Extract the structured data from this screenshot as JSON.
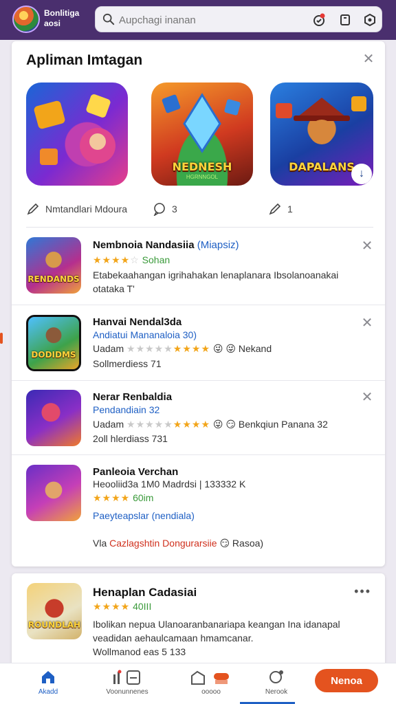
{
  "app": {
    "name": "Bonlitiga",
    "name_line2": "aosi"
  },
  "search": {
    "placeholder": "Aupchagi inanan",
    "badge_color": "#e53935"
  },
  "card1": {
    "title": "Apliman Imtagan",
    "featured": [
      {
        "caption": "",
        "sub": ""
      },
      {
        "caption": "NEDNESH",
        "sub": "HGRNNGOL"
      },
      {
        "caption": "DAPALANS",
        "sub": "",
        "icon": "download-arrow-icon"
      }
    ],
    "actions": [
      {
        "icon": "pen-icon",
        "label": "Nmtandlari Mdoura"
      },
      {
        "icon": "comment-icon",
        "label": "3"
      },
      {
        "icon": "pencil-icon",
        "label": "1"
      }
    ],
    "rows": [
      {
        "title": "Nembnoia Nandasiia",
        "dev": "(Miapsiz)",
        "rating_stars": "★★★★",
        "rating_empty": "☆",
        "rating_text": "Sohan",
        "desc1": "Etabekaahangan igrihahakan lenaplanara Ibsolanoanakai",
        "desc2": "otataka T'",
        "thumb_word": "RENDANDS"
      },
      {
        "title": "Hanvai Nendal3da",
        "dev": "Andiatui Mananaloia 30)",
        "line2_prefix": "Uadam",
        "stars_empty": "★★★★★",
        "stars": "★★★★",
        "line2_suffix": "😜 😜 Nekand",
        "line3": "Sollmerdiess 71",
        "thumb_word": "DODIDMS"
      },
      {
        "title": "Nerar Renbaldia",
        "dev": "Pendandiain 32",
        "line2_prefix": "Uadam",
        "stars_empty": "★★★★★",
        "stars": "★★★★",
        "line2_suffix": "😜 😏 Benkqiun Panana 32",
        "line3": "2oll hlerdiass 731",
        "thumb_word": ""
      },
      {
        "title": "Panleoia Verchan",
        "line2": "Heooliid3a 1M0 Madrdsi | 133332 K",
        "stars": "★★★★",
        "rating_text": "60im",
        "link": "Paeyteapslar (nendiala)",
        "bottom_prefix": "Vla",
        "bottom_red": "Cazlagshtin Dongurarsiie",
        "bottom_suffix": "😏 Rasoa)",
        "thumb_word": ""
      }
    ]
  },
  "card2": {
    "title": "Henaplan Cadasiai",
    "stars": "★★★★",
    "rating_text": "40III",
    "desc1": "Ibolikan nepua Ulanoaranbanariapa keangan Ina idanapal",
    "desc2": "veadidan aehaulcamaan hmamcanar.",
    "desc3": "Wollmanod eas 5 133",
    "thumb_word": "ROUNDLAH"
  },
  "bottomnav": {
    "items": [
      {
        "label": "Akadd",
        "icon": "home-icon"
      },
      {
        "label": "Voonunnenes",
        "icon": "library-icon"
      },
      {
        "label": "ooooo",
        "icon": "gift-icon"
      },
      {
        "label": "Nerook",
        "icon": "profile-icon"
      }
    ],
    "cta": "Nenoa"
  },
  "colors": {
    "topbar": "#4a2f6e",
    "accent": "#1e5fc4",
    "cta": "#e4531f",
    "star": "#f2a51a"
  }
}
